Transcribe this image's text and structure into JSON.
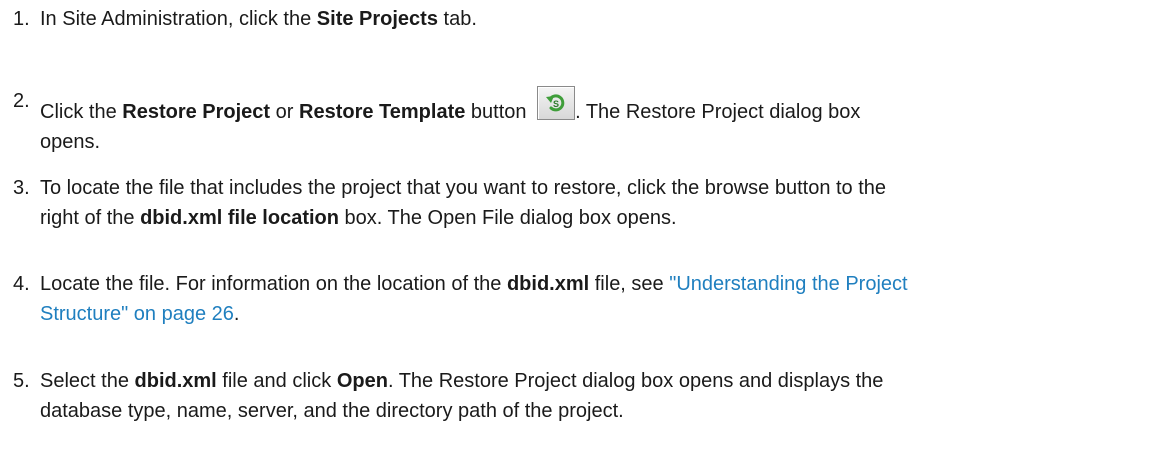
{
  "steps": [
    {
      "num": "1.",
      "pre": "In Site Administration, click the ",
      "bold": "Site Projects",
      "post": " tab."
    },
    {
      "num": "2.",
      "pre": "Click the ",
      "bold1": "Restore Project",
      "mid": " or ",
      "bold2": "Restore Template",
      "post1": " button ",
      "button_icon": "restore-arrow-icon",
      "post2": ". The Restore Project dialog box",
      "line2": "opens."
    },
    {
      "num": "3.",
      "line1": "To locate the file that includes the project that you want to restore, click the browse button to the",
      "pre": "right of the ",
      "bold": "dbid.xml file location",
      "post": " box. The Open File dialog box opens."
    },
    {
      "num": "4.",
      "pre": "Locate the file. For information on the location of the ",
      "bold": "dbid.xml",
      "post": " file, see ",
      "link1": "\"Understanding the Project",
      "link2": "Structure\" on page 26",
      "end": "."
    },
    {
      "num": "5.",
      "pre": "Select the ",
      "bold1": "dbid.xml",
      "mid": " file and click ",
      "bold2": "Open",
      "post": ". The Restore Project dialog box opens and displays the",
      "line2": "database type, name, server, and the directory path of the project."
    }
  ],
  "colors": {
    "text": "#1a1a1a",
    "link": "#1f7fbf",
    "icon_green": "#3f9e3a"
  }
}
